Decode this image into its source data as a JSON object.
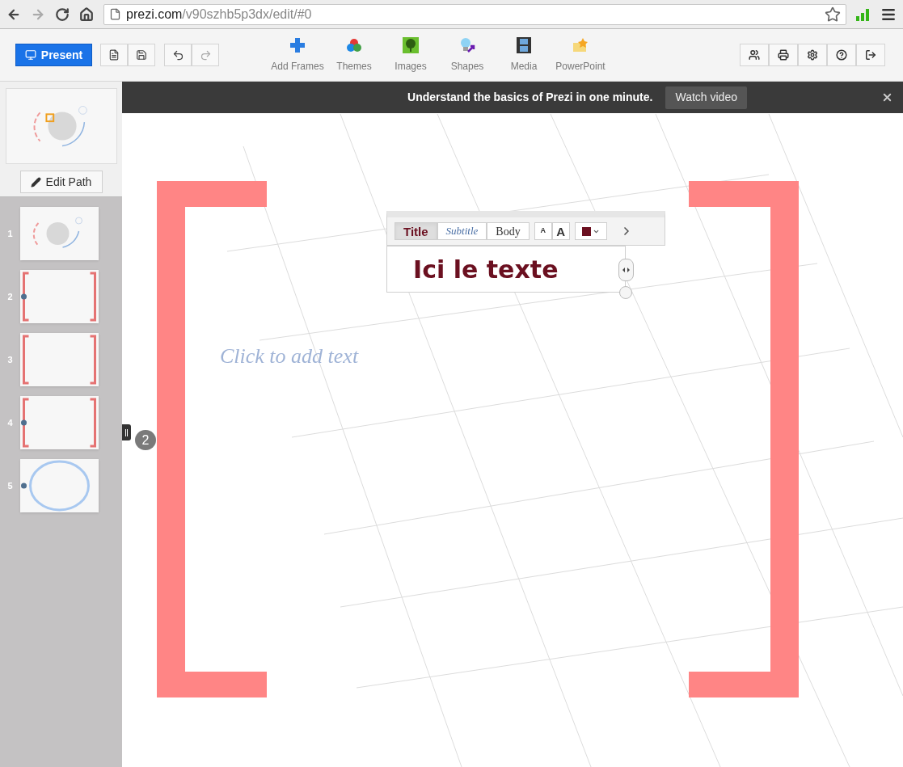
{
  "browser": {
    "url_host": "prezi.com",
    "url_path": "/v90szhb5p3dx/edit/#0"
  },
  "toolbar": {
    "present": "Present",
    "inserts": [
      {
        "label": "Add Frames",
        "kind": "frames"
      },
      {
        "label": "Themes",
        "kind": "themes"
      },
      {
        "label": "Images",
        "kind": "images"
      },
      {
        "label": "Shapes",
        "kind": "shapes"
      },
      {
        "label": "Media",
        "kind": "media"
      },
      {
        "label": "PowerPoint",
        "kind": "powerpoint"
      }
    ]
  },
  "banner": {
    "text": "Understand the basics of Prezi in one minute.",
    "button": "Watch video"
  },
  "sidebar": {
    "edit_path": "Edit Path",
    "slides": [
      {
        "number": "1",
        "kind": "overview",
        "path_dot": false
      },
      {
        "number": "2",
        "kind": "brackets",
        "path_dot": true
      },
      {
        "number": "3",
        "kind": "brackets",
        "path_dot": false
      },
      {
        "number": "4",
        "kind": "brackets",
        "path_dot": true
      },
      {
        "number": "5",
        "kind": "circle",
        "path_dot": true
      }
    ]
  },
  "canvas": {
    "text_editor": {
      "styles": [
        {
          "label": "Title",
          "selected": true
        },
        {
          "label": "Subtitle",
          "selected": false
        },
        {
          "label": "Body",
          "selected": false
        }
      ],
      "size_buttons": [
        "A",
        "A"
      ],
      "text": "Ici le texte"
    },
    "placeholder": "Click to add text",
    "path_step": "2"
  }
}
